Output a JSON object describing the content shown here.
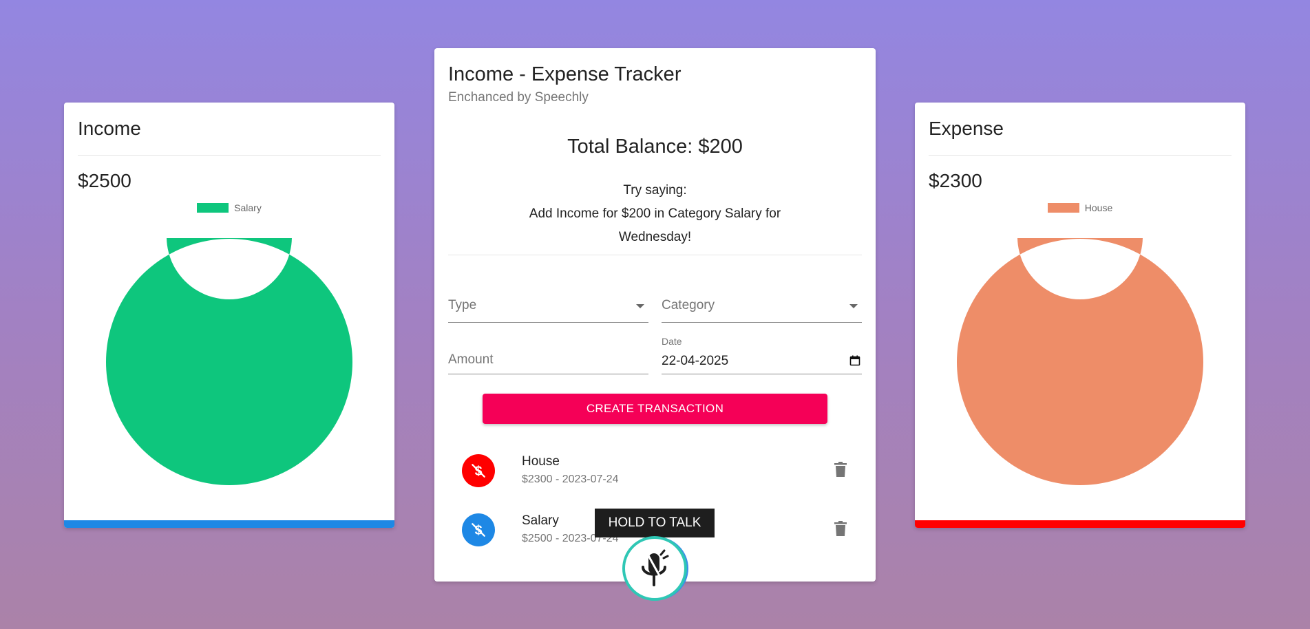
{
  "income": {
    "title": "Income",
    "amount": "$2500",
    "legend_label": "Salary",
    "color": "#0ec67d",
    "bar_color": "#1e88e5",
    "chart_data": {
      "type": "pie",
      "categories": [
        "Salary"
      ],
      "values": [
        2500
      ],
      "colors": [
        "#0ec67d"
      ],
      "legend": "top"
    }
  },
  "expense": {
    "title": "Expense",
    "amount": "$2300",
    "legend_label": "House",
    "color": "#ee8d68",
    "bar_color": "#ff0000",
    "chart_data": {
      "type": "pie",
      "categories": [
        "House"
      ],
      "values": [
        2300
      ],
      "colors": [
        "#ee8d68"
      ],
      "legend": "top"
    }
  },
  "main": {
    "title": "Income - Expense Tracker",
    "subtitle": "Enchanced by Speechly",
    "balance": "Total Balance: $200",
    "hint_line1": "Try saying:",
    "hint_line2": "Add Income for $200 in Category Salary for",
    "hint_line3": "Wednesday!",
    "form": {
      "type_label": "Type",
      "category_label": "Category",
      "amount_placeholder": "Amount",
      "date_label": "Date",
      "date_value": "22-04-2025",
      "submit_label": "CREATE TRANSACTION"
    },
    "transactions": [
      {
        "name": "House",
        "meta": "$2300 - 2023-07-24",
        "color": "#ff0000",
        "icon": "money-off-icon"
      },
      {
        "name": "Salary",
        "meta": "$2500 - 2023-07-24",
        "color": "#1e88e5",
        "icon": "money-off-icon"
      }
    ]
  },
  "voice": {
    "tooltip": "HOLD TO TALK",
    "icon": "microphone-icon"
  }
}
